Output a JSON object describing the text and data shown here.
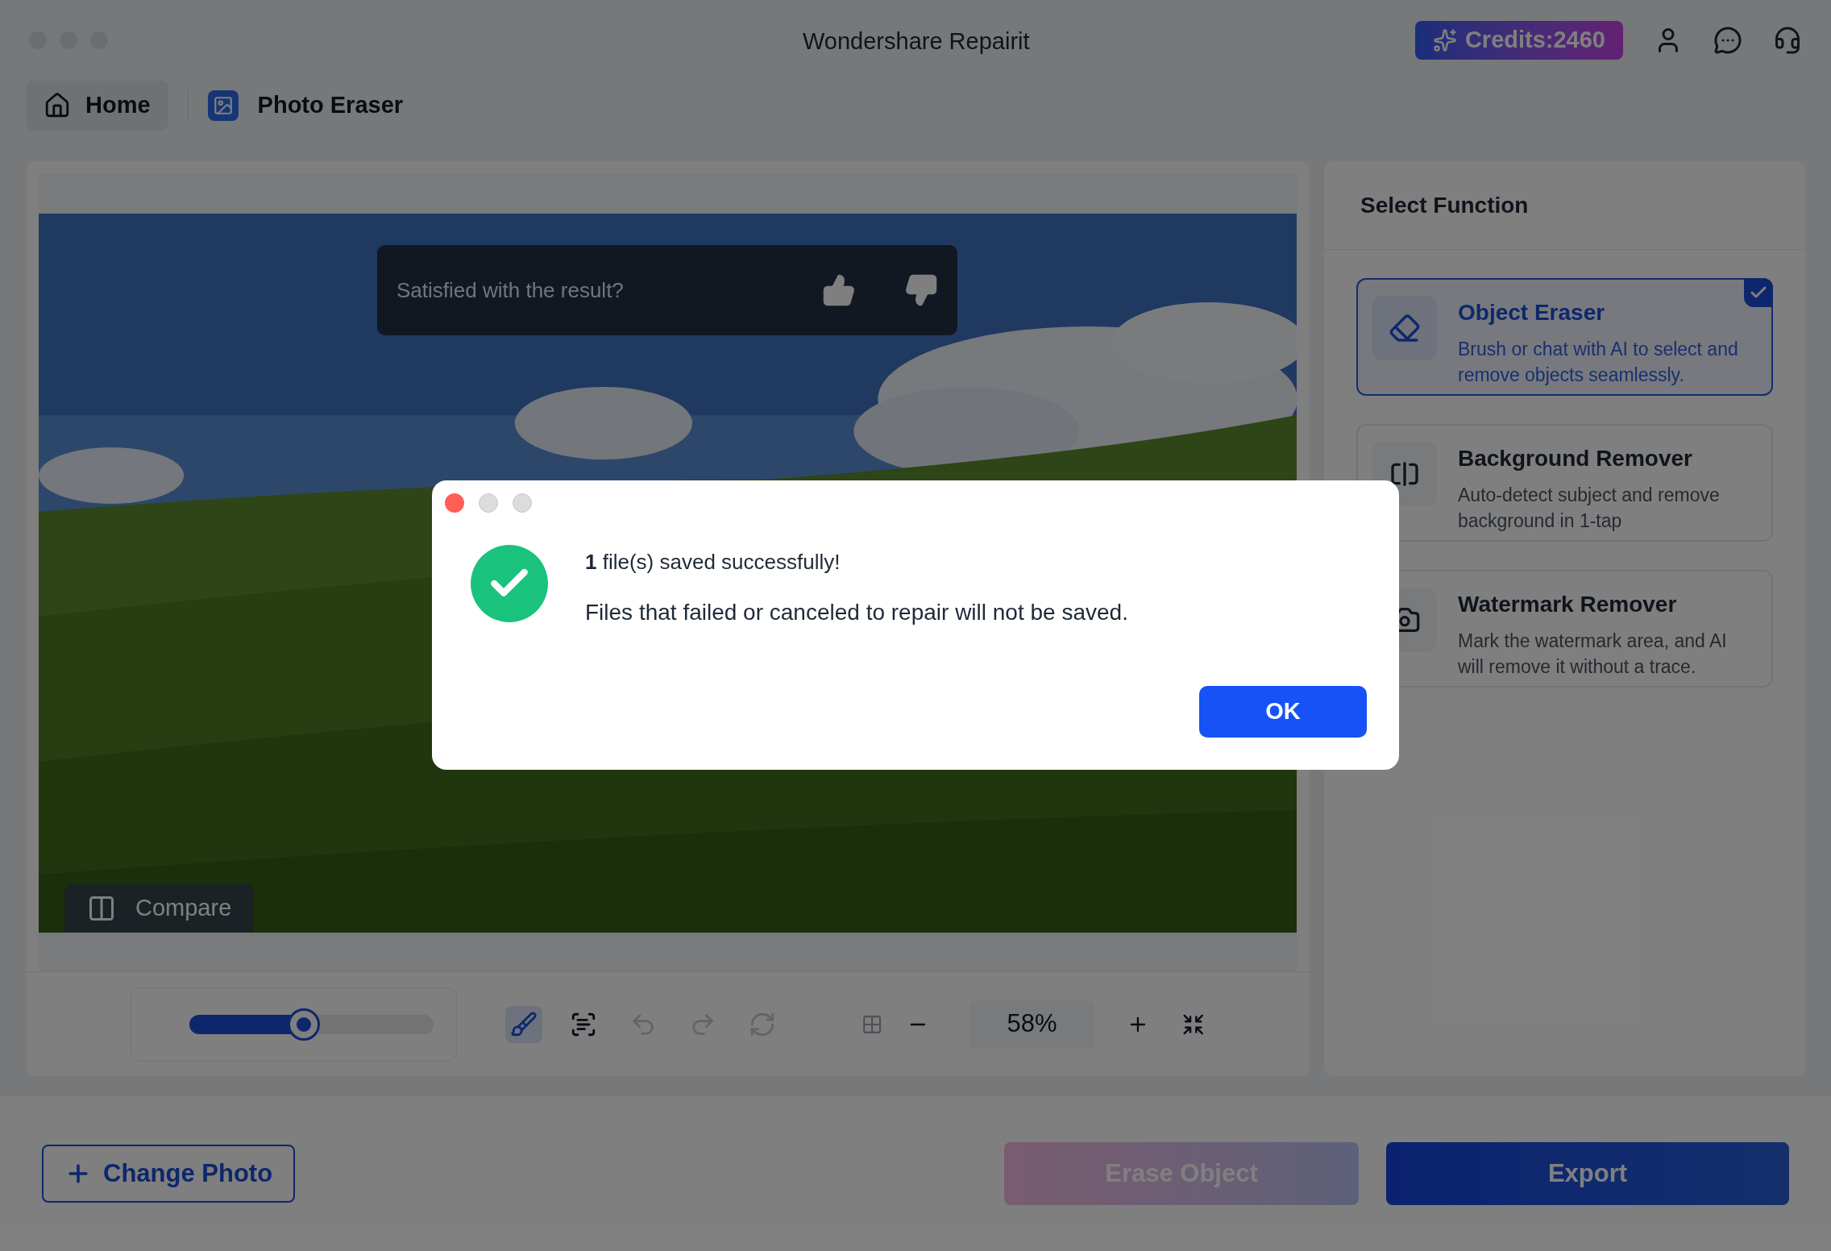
{
  "window": {
    "title": "Wondershare Repairit"
  },
  "credits": "Credits:2460",
  "nav": {
    "home": "Home",
    "page": "Photo Eraser"
  },
  "canvas": {
    "feedback": {
      "question": "Satisfied with the result?"
    },
    "compare": "Compare"
  },
  "toolbar": {
    "brush_size": {
      "level": 0.47
    },
    "tools": [
      {
        "kind": "brush",
        "selected": true,
        "disabled": false
      },
      {
        "kind": "ai",
        "selected": false,
        "disabled": false
      },
      {
        "kind": "undo",
        "selected": false,
        "disabled": true
      },
      {
        "kind": "redo",
        "selected": false,
        "disabled": true
      },
      {
        "kind": "reset",
        "selected": false,
        "disabled": true
      }
    ],
    "zoom": "58%"
  },
  "sidebar": {
    "title": "Select Function",
    "items": [
      {
        "kind": "eraser",
        "title": "Object Eraser",
        "description": "Brush or chat with AI to select and remove objects seamlessly.",
        "selected": true
      },
      {
        "kind": "background",
        "title": "Background Remover",
        "description": "Auto-detect subject and remove background in 1-tap",
        "selected": false
      },
      {
        "kind": "watermark",
        "title": "Watermark Remover",
        "description": "Mark the watermark area, and AI will remove it without a trace.",
        "selected": false
      }
    ]
  },
  "bottom": {
    "change_photo": "Change Photo",
    "buttons": [
      {
        "label": "Erase Object",
        "kind": "erase",
        "disabled": true
      },
      {
        "label": "Export",
        "kind": "export",
        "disabled": false
      }
    ]
  },
  "dialog": {
    "title_line": "**1** file(s) saved successfully!",
    "message": "Files that failed or canceled to repair will not be saved.",
    "button": "OK"
  }
}
